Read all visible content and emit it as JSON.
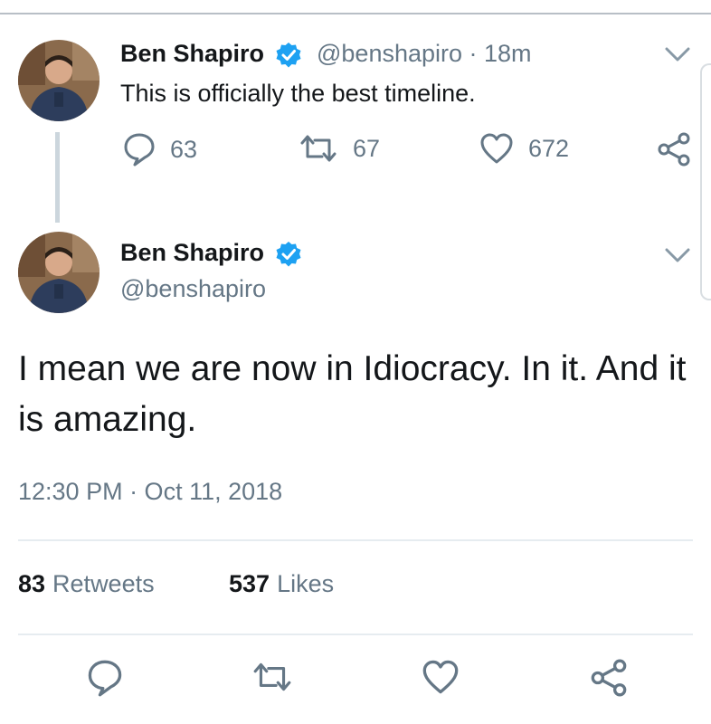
{
  "colors": {
    "text": "#14171a",
    "secondary": "#657786",
    "verified": "#1da1f2",
    "divider": "#e6ecf0",
    "thread_line": "#ccd6dd"
  },
  "parent_tweet": {
    "author_name": "Ben Shapiro",
    "handle_time": "@benshapiro · 18m",
    "text": "This is officially the best timeline.",
    "reply_count": "63",
    "retweet_count": "67",
    "like_count": "672",
    "icons": [
      "chevron-down-icon",
      "reply-icon",
      "retweet-icon",
      "like-icon",
      "share-icon"
    ]
  },
  "main_tweet": {
    "author_name": "Ben Shapiro",
    "handle": "@benshapiro",
    "text": "I mean we are now in Idiocracy. In it. And it is amazing.",
    "timestamp": "12:30 PM · Oct 11, 2018",
    "retweets_count": "83",
    "retweets_label": "Retweets",
    "likes_count": "537",
    "likes_label": "Likes",
    "icons": [
      "chevron-down-icon",
      "verified-badge-icon",
      "reply-icon",
      "retweet-icon",
      "like-icon",
      "share-icon"
    ]
  }
}
